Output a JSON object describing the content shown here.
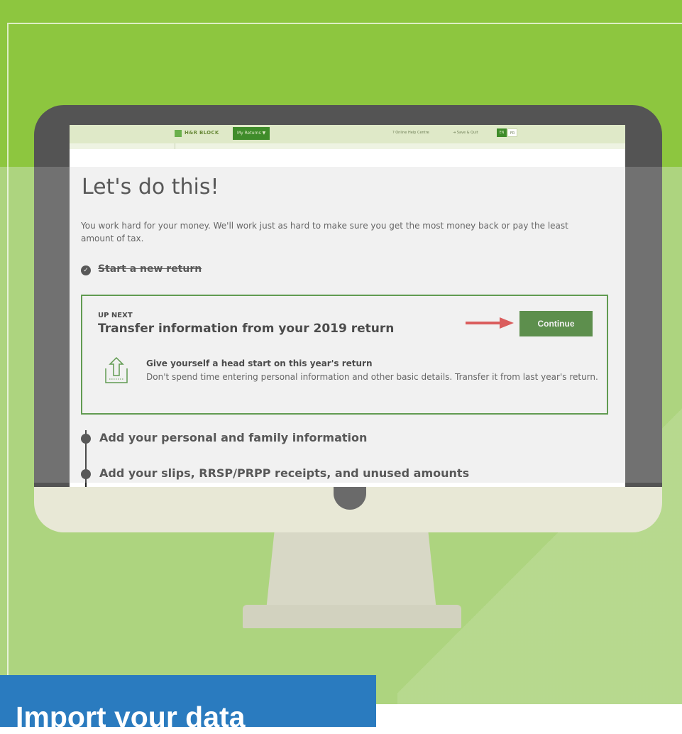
{
  "app": {
    "logo_text": "H&R BLOCK",
    "menu_label": "My Returns ▼",
    "help_link": "? Online Help Centre",
    "save_link": "⇥ Save & Quit",
    "lang_en": "EN",
    "lang_fr": "FR"
  },
  "page": {
    "heading": "Let's do this!",
    "intro": "You work hard for your money. We'll work just as hard to make sure you get the most money back or pay the least amount of tax.",
    "completed_step": "Start a new return"
  },
  "card": {
    "eyebrow": "UP NEXT",
    "title": "Transfer information from your 2019 return",
    "button_label": "Continue",
    "benefit_title": "Give yourself a head start on this year's return",
    "benefit_desc": "Don't spend time entering personal information and other basic details. Transfer it from last year's return."
  },
  "steps": [
    {
      "label": "Add your personal and family information"
    },
    {
      "label": "Add your slips, RRSP/PRPP receipts, and unused amounts"
    }
  ],
  "banner": {
    "label": "Import your data"
  },
  "colors": {
    "green_top": "#8dc63f",
    "green_bottom": "#add47f",
    "button_green": "#3a7d25",
    "arrow_red": "#e03a3a",
    "banner_blue": "#2a7bbf"
  },
  "icons": [
    "check-circle-icon",
    "arrow-right-icon",
    "upload-tray-icon",
    "step-dot-icon"
  ]
}
